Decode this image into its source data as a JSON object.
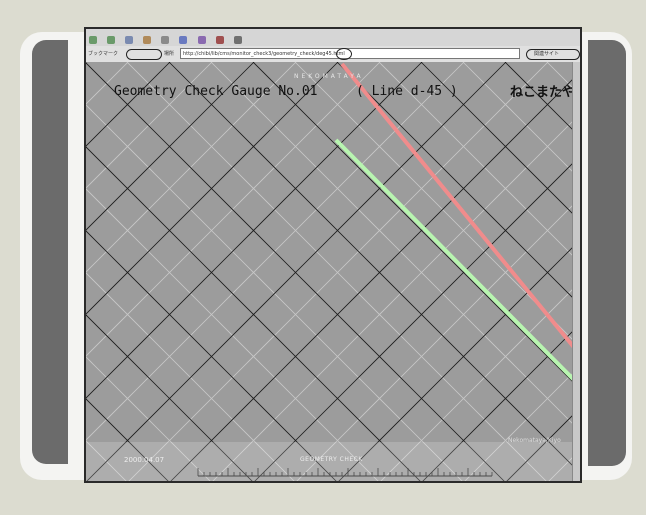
{
  "toolbar": {
    "icons": [
      "back-icon",
      "forward-icon",
      "reload-icon",
      "home-icon",
      "search-icon",
      "bookmark-icon",
      "print-icon",
      "security-icon",
      "stop-icon"
    ]
  },
  "address_bar": {
    "bookmarks_label": "ブックマーク",
    "location_label": "場所",
    "url": "http://chibi/lib/cms/monitor_check3/geometry_check/deg45.html",
    "related_label": "関連サイト"
  },
  "gauge": {
    "brand_top": "NEKOMATAYA",
    "title": "Geometry Check Gauge No.01",
    "line_label": "( Line d-45 )",
    "brand_logo": "ねこまたや",
    "date": "2000.04.07",
    "footer_label": "GEOMETRY CHECK",
    "footer_right": "Nekomataya/Kiyo",
    "colors": {
      "background": "#9c9c9c",
      "grid_line": "#1a1a1a",
      "faint_grid": "#c8c8c8",
      "red_line": "#f08c8c",
      "green_line": "#b8f5b0"
    }
  }
}
